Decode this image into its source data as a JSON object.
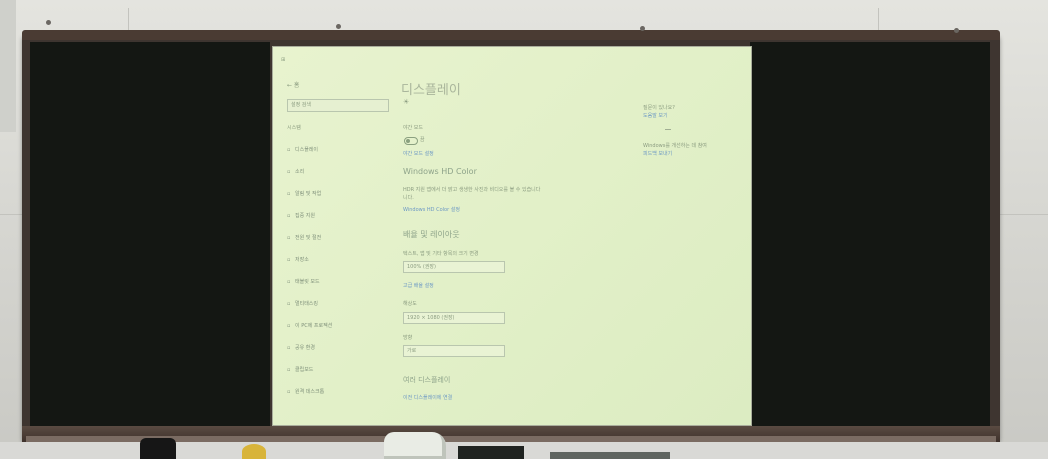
{
  "screen": {
    "header_glyph": "⊞",
    "back_label": "← 홈",
    "search_placeholder": "설정 검색",
    "home_label": "시스템",
    "title": "디스플레이",
    "subtitle": "☀",
    "night_light_label": "야간 모드",
    "night_light_state": "끔",
    "night_light_link": "야간 모드 설정",
    "hdr_heading": "Windows HD Color",
    "hdr_desc_1": "HDR 지원 앱에서 더 밝고 생생한 사진과 비디오를 볼 수 있습니다",
    "hdr_desc_2": "니다.",
    "hdr_link": "Windows HD Color 설정",
    "scale_heading": "배율 및 레이아웃",
    "scale_label": "텍스트, 앱 및 기타 항목의 크기 변경",
    "scale_value": "100% (권장)",
    "scale_link": "고급 배율 설정",
    "resolution_label": "해상도",
    "resolution_value": "1920 × 1080 (권장)",
    "orientation_label": "방향",
    "orientation_value": "가로",
    "multi_heading": "여러 디스플레이",
    "multi_link": "이전 디스플레이에 연결",
    "side_q_1": "질문이 있나요?",
    "side_link_1": "도움말 보기",
    "side_q_2": "Windows를 개선하는 데 참여",
    "side_link_2": "피드백 보내기",
    "nav": [
      {
        "label": "디스플레이",
        "icon": "display-icon"
      },
      {
        "label": "소리",
        "icon": "sound-icon"
      },
      {
        "label": "알림 및 작업",
        "icon": "notification-icon"
      },
      {
        "label": "집중 지원",
        "icon": "focus-icon"
      },
      {
        "label": "전원 및 절전",
        "icon": "power-icon"
      },
      {
        "label": "저장소",
        "icon": "storage-icon"
      },
      {
        "label": "태블릿 모드",
        "icon": "tablet-icon"
      },
      {
        "label": "멀티태스킹",
        "icon": "multitask-icon"
      },
      {
        "label": "이 PC에 프로젝션",
        "icon": "project-icon"
      },
      {
        "label": "공유 환경",
        "icon": "share-icon"
      },
      {
        "label": "클립보드",
        "icon": "clipboard-icon"
      },
      {
        "label": "원격 데스크톱",
        "icon": "remote-icon"
      }
    ]
  },
  "colors": {
    "screen_bg": "#e2f0c8",
    "chalkboard": "#141713",
    "frame": "#3e3530",
    "link": "#6c98c4"
  }
}
